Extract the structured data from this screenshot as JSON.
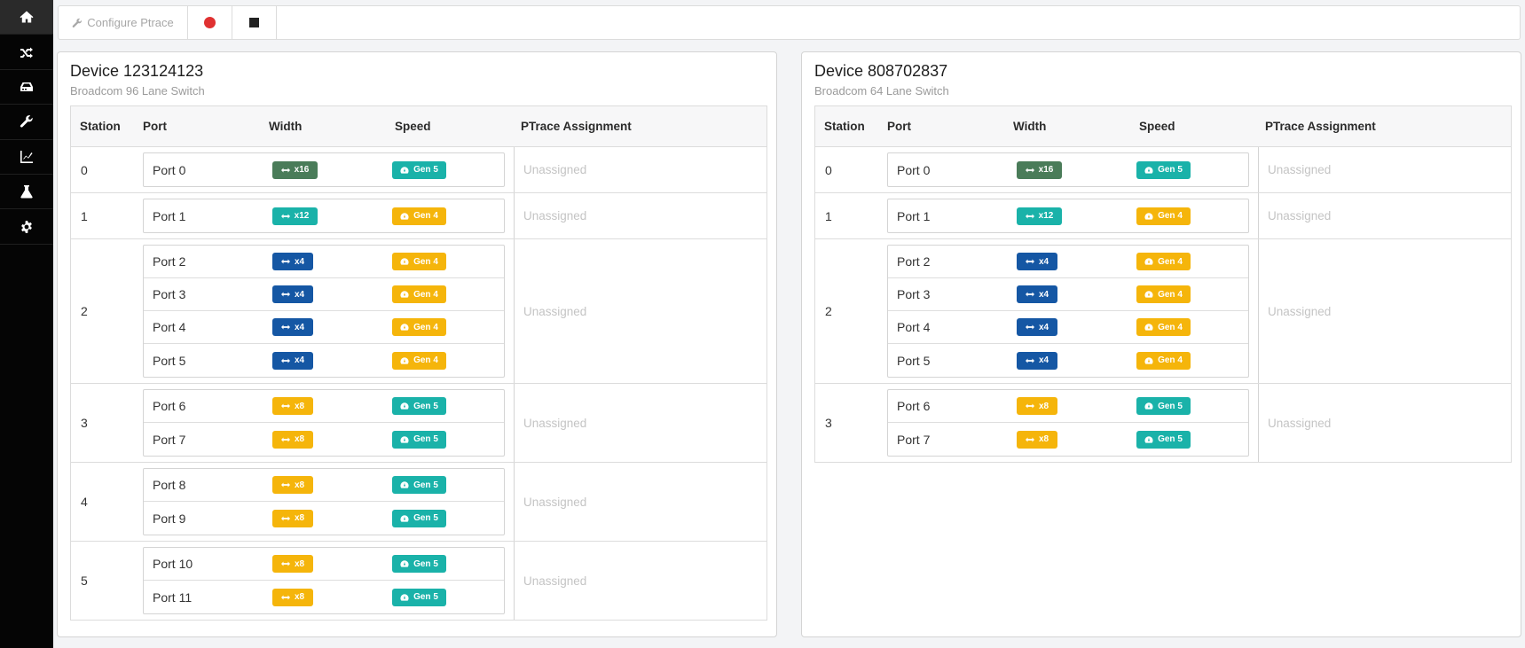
{
  "sidebar": {
    "items": [
      {
        "icon": "home-icon",
        "active": true
      },
      {
        "icon": "shuffle-icon",
        "active": false
      },
      {
        "icon": "storage-icon",
        "active": false
      },
      {
        "icon": "wrench-icon",
        "active": false
      },
      {
        "icon": "chart-icon",
        "active": false
      },
      {
        "icon": "flask-icon",
        "active": false
      },
      {
        "icon": "gear-icon",
        "active": false
      }
    ]
  },
  "toolbar": {
    "configure_label": "Configure Ptrace",
    "record_icon": "record-icon",
    "stop_icon": "stop-icon"
  },
  "colors": {
    "x16": "#4a7c59",
    "x12": "#1ab2a9",
    "x4": "#1557a4",
    "x8": "#f5b50b",
    "Gen 5": "#1ab2a9",
    "Gen 4": "#f5b50b"
  },
  "columns": [
    "Station",
    "Port",
    "Width",
    "Speed",
    "PTrace Assignment"
  ],
  "devices": [
    {
      "title": "Device 123124123",
      "subtitle": "Broadcom 96 Lane Switch",
      "stations": [
        {
          "station": "0",
          "ptrace": "Unassigned",
          "ports": [
            {
              "name": "Port 0",
              "width": "x16",
              "speed": "Gen 5"
            }
          ]
        },
        {
          "station": "1",
          "ptrace": "Unassigned",
          "ports": [
            {
              "name": "Port 1",
              "width": "x12",
              "speed": "Gen 4"
            }
          ]
        },
        {
          "station": "2",
          "ptrace": "Unassigned",
          "ports": [
            {
              "name": "Port 2",
              "width": "x4",
              "speed": "Gen 4"
            },
            {
              "name": "Port 3",
              "width": "x4",
              "speed": "Gen 4"
            },
            {
              "name": "Port 4",
              "width": "x4",
              "speed": "Gen 4"
            },
            {
              "name": "Port 5",
              "width": "x4",
              "speed": "Gen 4"
            }
          ]
        },
        {
          "station": "3",
          "ptrace": "Unassigned",
          "ports": [
            {
              "name": "Port 6",
              "width": "x8",
              "speed": "Gen 5"
            },
            {
              "name": "Port 7",
              "width": "x8",
              "speed": "Gen 5"
            }
          ]
        },
        {
          "station": "4",
          "ptrace": "Unassigned",
          "ports": [
            {
              "name": "Port 8",
              "width": "x8",
              "speed": "Gen 5"
            },
            {
              "name": "Port 9",
              "width": "x8",
              "speed": "Gen 5"
            }
          ]
        },
        {
          "station": "5",
          "ptrace": "Unassigned",
          "ports": [
            {
              "name": "Port 10",
              "width": "x8",
              "speed": "Gen 5"
            },
            {
              "name": "Port 11",
              "width": "x8",
              "speed": "Gen 5"
            }
          ]
        }
      ]
    },
    {
      "title": "Device 808702837",
      "subtitle": "Broadcom 64 Lane Switch",
      "stations": [
        {
          "station": "0",
          "ptrace": "Unassigned",
          "ports": [
            {
              "name": "Port 0",
              "width": "x16",
              "speed": "Gen 5"
            }
          ]
        },
        {
          "station": "1",
          "ptrace": "Unassigned",
          "ports": [
            {
              "name": "Port 1",
              "width": "x12",
              "speed": "Gen 4"
            }
          ]
        },
        {
          "station": "2",
          "ptrace": "Unassigned",
          "ports": [
            {
              "name": "Port 2",
              "width": "x4",
              "speed": "Gen 4"
            },
            {
              "name": "Port 3",
              "width": "x4",
              "speed": "Gen 4"
            },
            {
              "name": "Port 4",
              "width": "x4",
              "speed": "Gen 4"
            },
            {
              "name": "Port 5",
              "width": "x4",
              "speed": "Gen 4"
            }
          ]
        },
        {
          "station": "3",
          "ptrace": "Unassigned",
          "ports": [
            {
              "name": "Port 6",
              "width": "x8",
              "speed": "Gen 5"
            },
            {
              "name": "Port 7",
              "width": "x8",
              "speed": "Gen 5"
            }
          ]
        }
      ]
    }
  ]
}
